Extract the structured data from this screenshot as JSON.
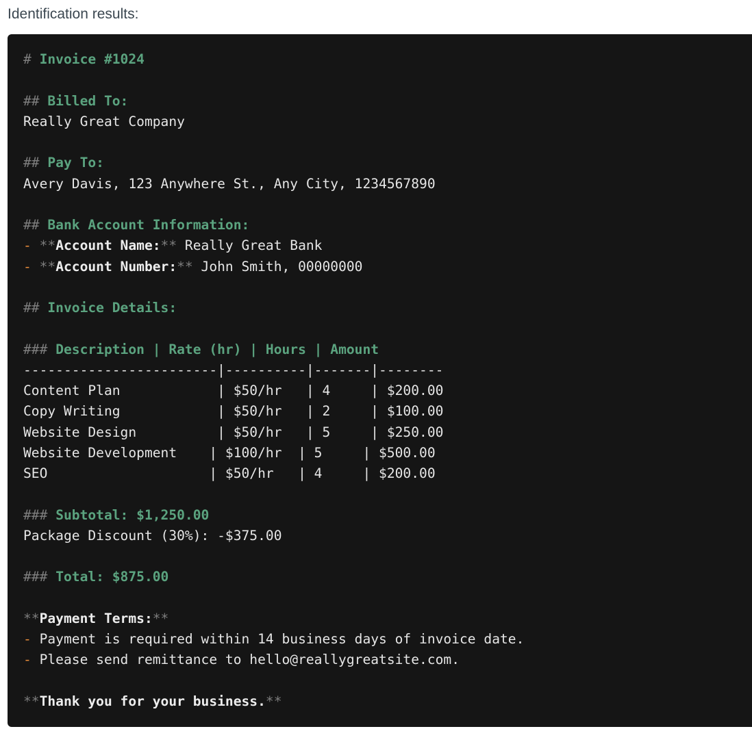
{
  "caption": "Identification results:",
  "lines": [
    [
      {
        "t": "# ",
        "c": "mk"
      },
      {
        "t": "Invoice #1024",
        "c": "hd"
      }
    ],
    [],
    [
      {
        "t": "## ",
        "c": "mk"
      },
      {
        "t": "Billed To:",
        "c": "hd"
      }
    ],
    [
      {
        "t": "Really Great Company",
        "c": "tx"
      }
    ],
    [],
    [
      {
        "t": "## ",
        "c": "mk"
      },
      {
        "t": "Pay To:",
        "c": "hd"
      }
    ],
    [
      {
        "t": "Avery Davis, 123 Anywhere St., Any City, 1234567890",
        "c": "tx"
      }
    ],
    [],
    [
      {
        "t": "## ",
        "c": "mk"
      },
      {
        "t": "Bank Account Information:",
        "c": "hd"
      }
    ],
    [
      {
        "t": "- ",
        "c": "bl"
      },
      {
        "t": "**",
        "c": "mk"
      },
      {
        "t": "Account Name:",
        "c": "bd"
      },
      {
        "t": "**",
        "c": "mk"
      },
      {
        "t": " Really Great Bank",
        "c": "tx"
      }
    ],
    [
      {
        "t": "- ",
        "c": "bl"
      },
      {
        "t": "**",
        "c": "mk"
      },
      {
        "t": "Account Number:",
        "c": "bd"
      },
      {
        "t": "**",
        "c": "mk"
      },
      {
        "t": " John Smith, 00000000",
        "c": "tx"
      }
    ],
    [],
    [
      {
        "t": "## ",
        "c": "mk"
      },
      {
        "t": "Invoice Details:",
        "c": "hd"
      }
    ],
    [],
    [
      {
        "t": "### ",
        "c": "mk"
      },
      {
        "t": "Description | Rate (hr) | Hours | Amount",
        "c": "hd"
      }
    ],
    [
      {
        "t": "------------------------|----------|-------|--------",
        "c": "tx"
      }
    ],
    [
      {
        "t": "Content Plan            | $50/hr   | 4     | $200.00",
        "c": "tx"
      }
    ],
    [
      {
        "t": "Copy Writing            | $50/hr   | 2     | $100.00",
        "c": "tx"
      }
    ],
    [
      {
        "t": "Website Design          | $50/hr   | 5     | $250.00",
        "c": "tx"
      }
    ],
    [
      {
        "t": "Website Development    | $100/hr  | 5     | $500.00",
        "c": "tx"
      }
    ],
    [
      {
        "t": "SEO                    | $50/hr   | 4     | $200.00",
        "c": "tx"
      }
    ],
    [],
    [
      {
        "t": "### ",
        "c": "mk"
      },
      {
        "t": "Subtotal: $1,250.00",
        "c": "hd"
      }
    ],
    [
      {
        "t": "Package Discount (30%): -$375.00",
        "c": "tx"
      }
    ],
    [],
    [
      {
        "t": "### ",
        "c": "mk"
      },
      {
        "t": "Total: $875.00",
        "c": "hd"
      }
    ],
    [],
    [
      {
        "t": "**",
        "c": "mk"
      },
      {
        "t": "Payment Terms:",
        "c": "bd"
      },
      {
        "t": "**",
        "c": "mk"
      }
    ],
    [
      {
        "t": "- ",
        "c": "bl"
      },
      {
        "t": "Payment is required within 14 business days of invoice date.",
        "c": "tx"
      }
    ],
    [
      {
        "t": "- ",
        "c": "bl"
      },
      {
        "t": "Please send remittance to hello@reallygreatsite.com.",
        "c": "tx"
      }
    ],
    [],
    [
      {
        "t": "**",
        "c": "mk"
      },
      {
        "t": "Thank you for your business.",
        "c": "bd"
      },
      {
        "t": "**",
        "c": "mk"
      }
    ]
  ]
}
